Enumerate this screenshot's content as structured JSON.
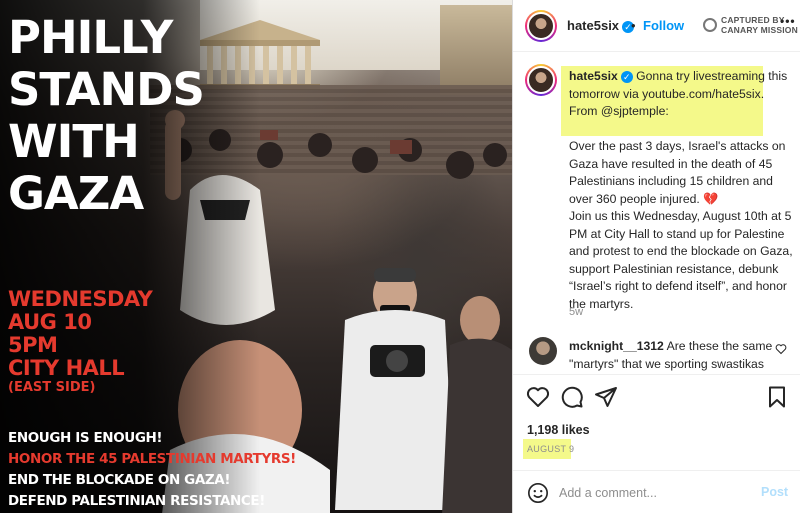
{
  "poster": {
    "title_lines": [
      "PHILLY",
      "STANDS",
      "WITH",
      "GAZA"
    ],
    "day": "WEDNESDAY",
    "date": "AUG 10",
    "time": "5PM",
    "place": "CITY HALL",
    "place_note": "(EAST SIDE)",
    "slogans": [
      {
        "text": "ENOUGH IS ENOUGH!",
        "color": "white"
      },
      {
        "text": "HONOR THE 45 PALESTINIAN MARTYRS!",
        "color": "red"
      },
      {
        "text": "END THE BLOCKADE ON GAZA!",
        "color": "white"
      },
      {
        "text": "DEFEND PALESTINIAN RESISTANCE!",
        "color": "white"
      }
    ],
    "colors": {
      "red": "#e53a2e",
      "white": "#ffffff"
    }
  },
  "post": {
    "header": {
      "username": "hate5six",
      "verified_icon": "verified-badge-icon",
      "follow_label": "Follow",
      "separator": "•",
      "watermark": [
        "CAPTURED BY",
        "CANARY MISSION"
      ],
      "more_icon": "•••"
    },
    "caption": {
      "username": "hate5six",
      "intro": "Gonna try livestreaming this tomorrow via youtube.com/hate5six. From @sjptemple:",
      "paragraph1": "Over the past 3 days, Israel's attacks on Gaza have resulted in the death of 45 Palestinians including 15 children and over 360 people injured.",
      "emoji": "💔",
      "paragraph2": "Join us this Wednesday, August 10th at 5 PM at City Hall to stand up for Palestine and protest to end the blockade on Gaza, support Palestinian resistance, debunk “Israel’s right to defend itself”, and honor the martyrs.",
      "age": "5w"
    },
    "comment": {
      "username": "mcknight__1312",
      "text": "Are these the same \"martyrs\" that we sporting swastikas"
    },
    "likes": "1,198 likes",
    "date": "AUGUST 9",
    "add_comment": {
      "placeholder": "Add a comment...",
      "post_label": "Post"
    },
    "colors": {
      "accent": "#0095f6",
      "highlight": "#f4f98a",
      "post_disabled": "#b2dffc"
    }
  }
}
